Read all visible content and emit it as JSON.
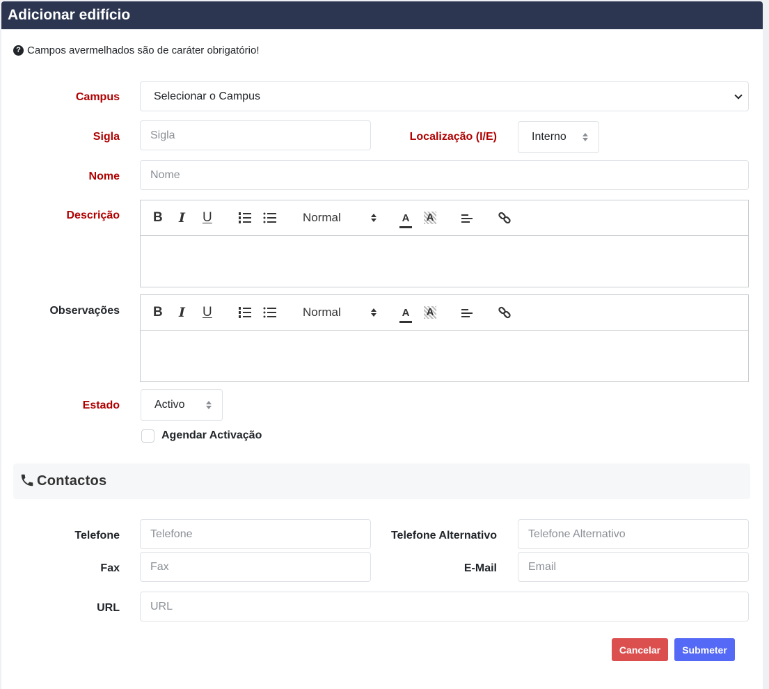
{
  "header": {
    "title": "Adicionar edifício"
  },
  "notice": {
    "icon": "question-circle-icon",
    "text": "Campos avermelhados são de caráter obrigatório!"
  },
  "form": {
    "campus": {
      "label": "Campus",
      "value": "Selecionar o Campus"
    },
    "sigla": {
      "label": "Sigla",
      "placeholder": "Sigla"
    },
    "localizacao": {
      "label": "Localização (I/E)",
      "value": "Interno"
    },
    "nome": {
      "label": "Nome",
      "placeholder": "Nome"
    },
    "descricao": {
      "label": "Descrição",
      "header_format": "Normal"
    },
    "observacoes": {
      "label": "Observações",
      "header_format": "Normal"
    },
    "estado": {
      "label": "Estado",
      "value": "Activo"
    },
    "agendar": {
      "label": "Agendar Activação",
      "checked": false
    }
  },
  "editor_toolbar": {
    "bold": "B",
    "italic": "I",
    "underline": "U",
    "text_color": "A",
    "background": "A"
  },
  "contactos": {
    "title": "Contactos",
    "icon": "phone-icon",
    "telefone": {
      "label": "Telefone",
      "placeholder": "Telefone"
    },
    "telefone_alt": {
      "label": "Telefone Alternativo",
      "placeholder": "Telefone Alternativo"
    },
    "fax": {
      "label": "Fax",
      "placeholder": "Fax"
    },
    "email": {
      "label": "E-Mail",
      "placeholder": "Email"
    },
    "url": {
      "label": "URL",
      "placeholder": "URL"
    }
  },
  "actions": {
    "cancel": "Cancelar",
    "submit": "Submeter"
  },
  "colors": {
    "header_bg": "#2c3651",
    "required": "#b00000",
    "cancel": "#dc4f4f",
    "submit": "#5469f5"
  }
}
